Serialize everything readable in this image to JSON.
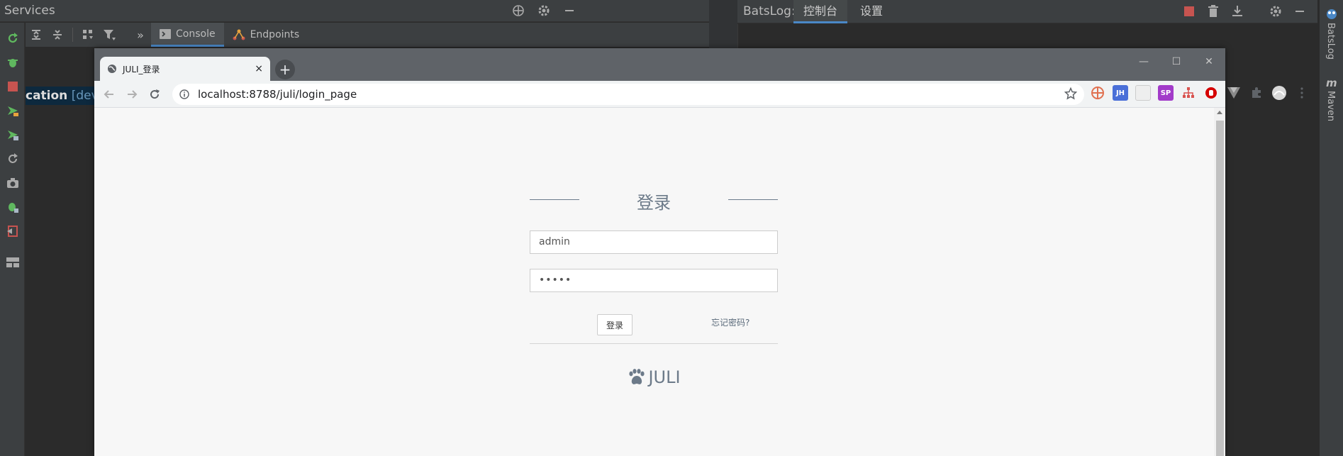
{
  "ide": {
    "services": {
      "title": "Services",
      "tabs": [
        {
          "label": "Console",
          "icon": "console-icon"
        },
        {
          "label": "Endpoints",
          "icon": "endpoints-icon"
        }
      ],
      "overflow_glyph": "»",
      "tree_node": {
        "name": "cation",
        "suffix": "[devto"
      }
    },
    "batslog": {
      "title": "BatsLog:",
      "tabs": [
        {
          "label": "控制台",
          "active": true
        },
        {
          "label": "设置",
          "active": false
        }
      ]
    },
    "right_strip": {
      "batslog_label": "BatsLog",
      "maven_label": "Maven"
    }
  },
  "browser": {
    "tab_title": "JULI_登录",
    "tab_close": "×",
    "new_tab": "+",
    "url": "localhost:8788/juli/login_page",
    "window_controls": {
      "minimize": "—",
      "maximize": "☐",
      "close": "✕"
    },
    "extensions": [
      "jh-extension-icon",
      "sp-extension-icon",
      "ublock-icon",
      "vue-devtools-icon",
      "puzzle-icon",
      "avatar-icon",
      "menu-icon"
    ],
    "ext_labels": {
      "jh": "JH",
      "sp": "SP"
    }
  },
  "login": {
    "title": "登录",
    "username_value": "admin",
    "password_value": "•••••",
    "submit_label": "登录",
    "forgot_label": "忘记密码?",
    "brand": "JULI"
  },
  "colors": {
    "ide_bg": "#2b2b2b",
    "ide_panel": "#3c3f41",
    "accent": "#4a88c7",
    "browser_frame": "#5f6368",
    "login_text": "#6c7a89"
  }
}
